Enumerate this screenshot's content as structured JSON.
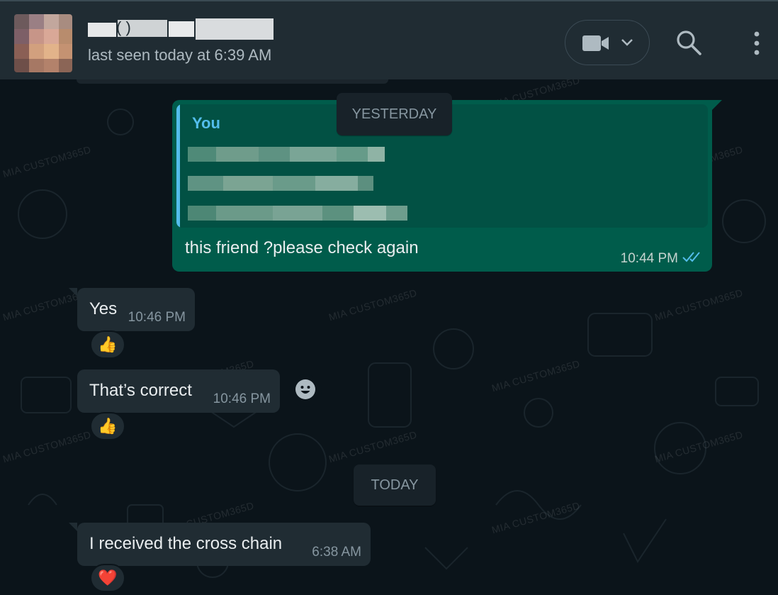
{
  "header": {
    "contact_name_visible": "( )",
    "last_seen": "last seen today at 6:39 AM",
    "video_call_icon": "video-camera-icon",
    "dropdown_icon": "chevron-down-icon",
    "search_icon": "search-icon",
    "menu_icon": "more-vertical-icon"
  },
  "watermark": "MIA CUSTOM365D",
  "chips": {
    "yesterday": "YESTERDAY",
    "today": "TODAY"
  },
  "messages": {
    "outgoing_1": {
      "quoted_author": "You",
      "text": "this friend ?please check again",
      "time": "10:44 PM",
      "status_icon": "double-check-read-icon"
    },
    "incoming_1": {
      "text": "Yes",
      "time": "10:46 PM",
      "reaction": "👍"
    },
    "incoming_2": {
      "text": "That’s correct",
      "time": "10:46 PM",
      "reaction": "👍"
    },
    "incoming_3": {
      "text": "I received the cross chain",
      "time": "6:38 AM",
      "reaction": "❤️"
    }
  },
  "colors": {
    "background": "#0b141a",
    "header": "#202c33",
    "outgoing_bubble": "#005c4b",
    "incoming_bubble": "#202c33",
    "accent_blue": "#53bdeb"
  }
}
